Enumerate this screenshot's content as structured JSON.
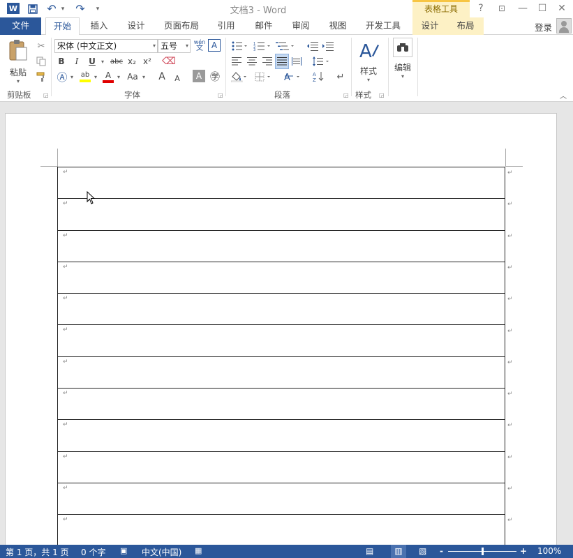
{
  "window": {
    "title": "文档3 - Word",
    "context_group": "表格工具",
    "help": "?",
    "minimize": "—",
    "restore": "☐",
    "close": "✕",
    "ribbon_display": "⊡"
  },
  "quick_access": {
    "undo": "↶",
    "redo": "↷",
    "more": "▾",
    "save": "💾"
  },
  "tabs": [
    {
      "label": "文件"
    },
    {
      "label": "开始"
    },
    {
      "label": "插入"
    },
    {
      "label": "设计"
    },
    {
      "label": "页面布局"
    },
    {
      "label": "引用"
    },
    {
      "label": "邮件"
    },
    {
      "label": "审阅"
    },
    {
      "label": "视图"
    },
    {
      "label": "开发工具"
    },
    {
      "label": "设计"
    },
    {
      "label": "布局"
    }
  ],
  "account": {
    "login": "登录"
  },
  "ribbon": {
    "clipboard": {
      "label": "剪贴板",
      "paste": "粘贴"
    },
    "font": {
      "label": "字体",
      "font_name": "宋体 (中文正文)",
      "font_size": "五号",
      "bold": "B",
      "italic": "I",
      "underline": "U",
      "strike": "abc",
      "sub": "x₂",
      "sup": "x²",
      "grow": "A",
      "shrink": "A",
      "case": "Aa",
      "wen": "wén",
      "wen_char": "文"
    },
    "paragraph": {
      "label": "段落"
    },
    "styles": {
      "label": "样式",
      "button": "样式"
    },
    "editing": {
      "button": "编辑"
    }
  },
  "document": {
    "rows": 12,
    "mark": "↵"
  },
  "status": {
    "page": "第 1 页，共 1 页",
    "words": "0 个字",
    "language": "中文(中国)",
    "zoom": "100%",
    "zoom_minus": "-",
    "zoom_plus": "+"
  }
}
